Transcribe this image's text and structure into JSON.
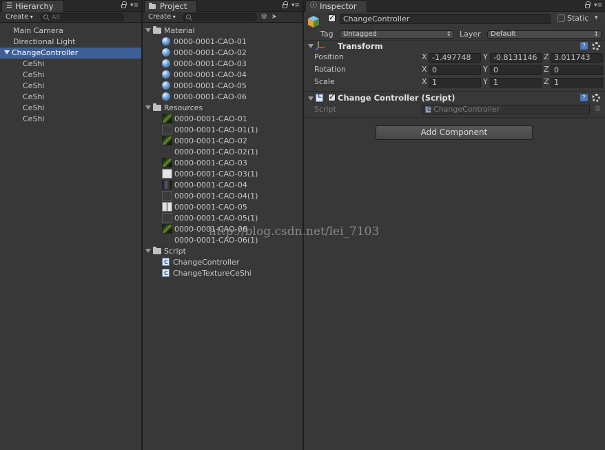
{
  "hierarchy": {
    "tab_label": "Hierarchy",
    "create_label": "Create",
    "search_placeholder": "All",
    "items": [
      {
        "label": "Main Camera",
        "indent": 0,
        "selected": false,
        "expanded": null
      },
      {
        "label": "Directional Light",
        "indent": 0,
        "selected": false,
        "expanded": null
      },
      {
        "label": "ChangeController",
        "indent": 0,
        "selected": true,
        "expanded": true
      },
      {
        "label": "CeShi",
        "indent": 1,
        "selected": false,
        "expanded": null
      },
      {
        "label": "CeShi",
        "indent": 1,
        "selected": false,
        "expanded": null
      },
      {
        "label": "CeShi",
        "indent": 1,
        "selected": false,
        "expanded": null
      },
      {
        "label": "CeShi",
        "indent": 1,
        "selected": false,
        "expanded": null
      },
      {
        "label": "CeShi",
        "indent": 1,
        "selected": false,
        "expanded": null
      },
      {
        "label": "CeShi",
        "indent": 1,
        "selected": false,
        "expanded": null
      }
    ]
  },
  "project": {
    "tab_label": "Project",
    "create_label": "Create",
    "folders": [
      {
        "name": "Material",
        "items": [
          {
            "label": "0000-0001-CAO-01",
            "icon": "material-sphere"
          },
          {
            "label": "0000-0001-CAO-02",
            "icon": "material-sphere"
          },
          {
            "label": "0000-0001-CAO-03",
            "icon": "material-sphere"
          },
          {
            "label": "0000-0001-CAO-04",
            "icon": "material-sphere"
          },
          {
            "label": "0000-0001-CAO-05",
            "icon": "material-sphere"
          },
          {
            "label": "0000-0001-CAO-06",
            "icon": "material-sphere"
          }
        ]
      },
      {
        "name": "Resources",
        "items": [
          {
            "label": "0000-0001-CAO-01",
            "icon": "texture-leaf"
          },
          {
            "label": "0000-0001-CAO-01(1)",
            "icon": "texture-blank"
          },
          {
            "label": "0000-0001-CAO-02",
            "icon": "texture-leaf"
          },
          {
            "label": "0000-0001-CAO-02(1)",
            "icon": "none"
          },
          {
            "label": "0000-0001-CAO-03",
            "icon": "texture-leaf"
          },
          {
            "label": "0000-0001-CAO-03(1)",
            "icon": "texture-white"
          },
          {
            "label": "0000-0001-CAO-04",
            "icon": "texture-purple"
          },
          {
            "label": "0000-0001-CAO-04(1)",
            "icon": "texture-blank"
          },
          {
            "label": "0000-0001-CAO-05",
            "icon": "texture-white-leaf"
          },
          {
            "label": "0000-0001-CAO-05(1)",
            "icon": "texture-blank"
          },
          {
            "label": "0000-0001-CAO-06",
            "icon": "texture-leaf"
          },
          {
            "label": "0000-0001-CAO-06(1)",
            "icon": "none"
          }
        ]
      },
      {
        "name": "Script",
        "items": [
          {
            "label": "ChangeController",
            "icon": "csharp-script"
          },
          {
            "label": "ChangeTextureCeShi",
            "icon": "csharp-script"
          }
        ]
      }
    ]
  },
  "watermark": "http://blog.csdn.net/lei_7103",
  "inspector": {
    "tab_label": "Inspector",
    "object_name": "ChangeController",
    "active": true,
    "static_label": "Static",
    "tag_label": "Tag",
    "tag_value": "Untagged",
    "layer_label": "Layer",
    "layer_value": "Default",
    "transform": {
      "title": "Transform",
      "rows": [
        {
          "label": "Position",
          "x": "-1.497748",
          "y": "-0.8131146",
          "z": "3.011743"
        },
        {
          "label": "Rotation",
          "x": "0",
          "y": "0",
          "z": "0"
        },
        {
          "label": "Scale",
          "x": "1",
          "y": "1",
          "z": "1"
        }
      ],
      "axis_x": "X",
      "axis_y": "Y",
      "axis_z": "Z"
    },
    "script_component": {
      "title": "Change Controller (Script)",
      "enabled": true,
      "script_label": "Script",
      "script_value": "ChangeController"
    },
    "add_component_label": "Add Component"
  },
  "colors": {
    "panel_bg": "#383838",
    "selection": "#3e5f96",
    "text": "#c8c8c8"
  }
}
